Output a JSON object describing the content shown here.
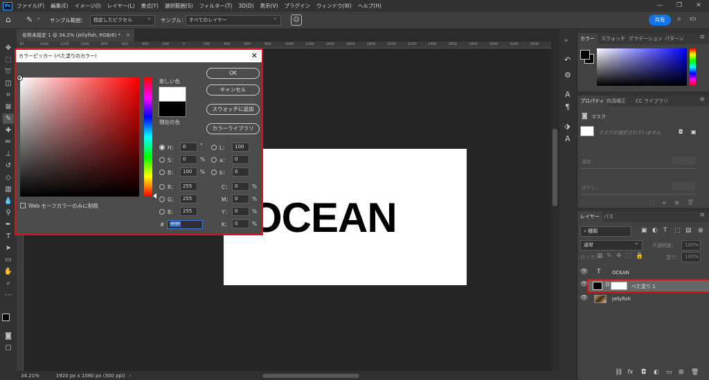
{
  "menubar": {
    "app_icon": "Ps",
    "items": [
      "ファイル(F)",
      "編集(E)",
      "イメージ(I)",
      "レイヤー(L)",
      "書式(Y)",
      "選択範囲(S)",
      "フィルター(T)",
      "3D(D)",
      "表示(V)",
      "プラグイン",
      "ウィンドウ(W)",
      "ヘルプ(H)"
    ],
    "window_controls": [
      "—",
      "❐",
      "✕"
    ]
  },
  "options": {
    "sample_size_label": "サンプル範囲：",
    "sample_size_value": "指定したピクセル",
    "sample_label": "サンプル：",
    "sample_value": "すべてのレイヤー",
    "share_label": "共有"
  },
  "document": {
    "tab_title": "名称未設定 1 @ 34.2% (jellyfish, RGB/8) *",
    "canvas_text": "OCEAN",
    "zoom": "34.21%",
    "doc_info": "1920 px x 1080 px (300 ppi)",
    "ruler_marks": [
      "30",
      "1400",
      "1200",
      "1000",
      "800",
      "600",
      "400",
      "200",
      "0",
      "200",
      "400",
      "600",
      "800",
      "1000",
      "1200",
      "1400",
      "1600",
      "1800",
      "2000",
      "2200",
      "2400",
      "2600",
      "2800",
      "3000",
      "3200",
      "3400"
    ]
  },
  "picker": {
    "title": "カラーピッカー (べた塗りのカラー)",
    "new_color_label": "新しい色",
    "current_color_label": "現在の色",
    "new_color": "#ffffff",
    "current_color": "#000000",
    "buttons": {
      "ok": "OK",
      "cancel": "キャンセル",
      "add_swatch": "スウォッチに追加",
      "libraries": "カラーライブラリ"
    },
    "web_safe_label": "Web セーフカラーのみに制限",
    "hsb": [
      {
        "label": "H：",
        "value": "0",
        "unit": "°"
      },
      {
        "label": "S：",
        "value": "0",
        "unit": "%"
      },
      {
        "label": "B：",
        "value": "100",
        "unit": "%"
      }
    ],
    "lab": [
      {
        "label": "L：",
        "value": "100"
      },
      {
        "label": "a：",
        "value": "0"
      },
      {
        "label": "b：",
        "value": "0"
      }
    ],
    "rgb": [
      {
        "label": "R：",
        "value": "255"
      },
      {
        "label": "G：",
        "value": "255"
      },
      {
        "label": "B：",
        "value": "255"
      }
    ],
    "cmyk": [
      {
        "label": "C：",
        "value": "0",
        "unit": "%"
      },
      {
        "label": "M：",
        "value": "0",
        "unit": "%"
      },
      {
        "label": "Y：",
        "value": "0",
        "unit": "%"
      },
      {
        "label": "K：",
        "value": "0",
        "unit": "%"
      }
    ],
    "hex_label": "#",
    "hex_value": "ffffff"
  },
  "color_panel": {
    "tabs": [
      "カラー",
      "スウォッチ",
      "グラデーション",
      "パターン"
    ]
  },
  "properties_panel": {
    "tabs": [
      "プロパティ",
      "色調補正",
      "CC ライブラリ"
    ],
    "mask_label": "マスク",
    "mask_msg": "マスクが選択されていません",
    "density_label": "濃度：",
    "feather_label": "ぼかし："
  },
  "layers_panel": {
    "tabs": [
      "レイヤー",
      "パス"
    ],
    "search_placeholder": "種類",
    "blend_mode": "通常",
    "opacity_label": "不透明度：",
    "opacity_value": "100%",
    "lock_label": "ロック：",
    "fill_label": "塗り：",
    "fill_value": "100%",
    "layers": [
      {
        "name": "OCEAN",
        "kind": "text"
      },
      {
        "name": "べた塗り 1",
        "kind": "fill",
        "selected": true
      },
      {
        "name": "jellyfish",
        "kind": "image"
      }
    ]
  },
  "colors": {
    "accent": "#1473e6",
    "highlight": "#e0101b",
    "selected_layer": "#666666"
  }
}
